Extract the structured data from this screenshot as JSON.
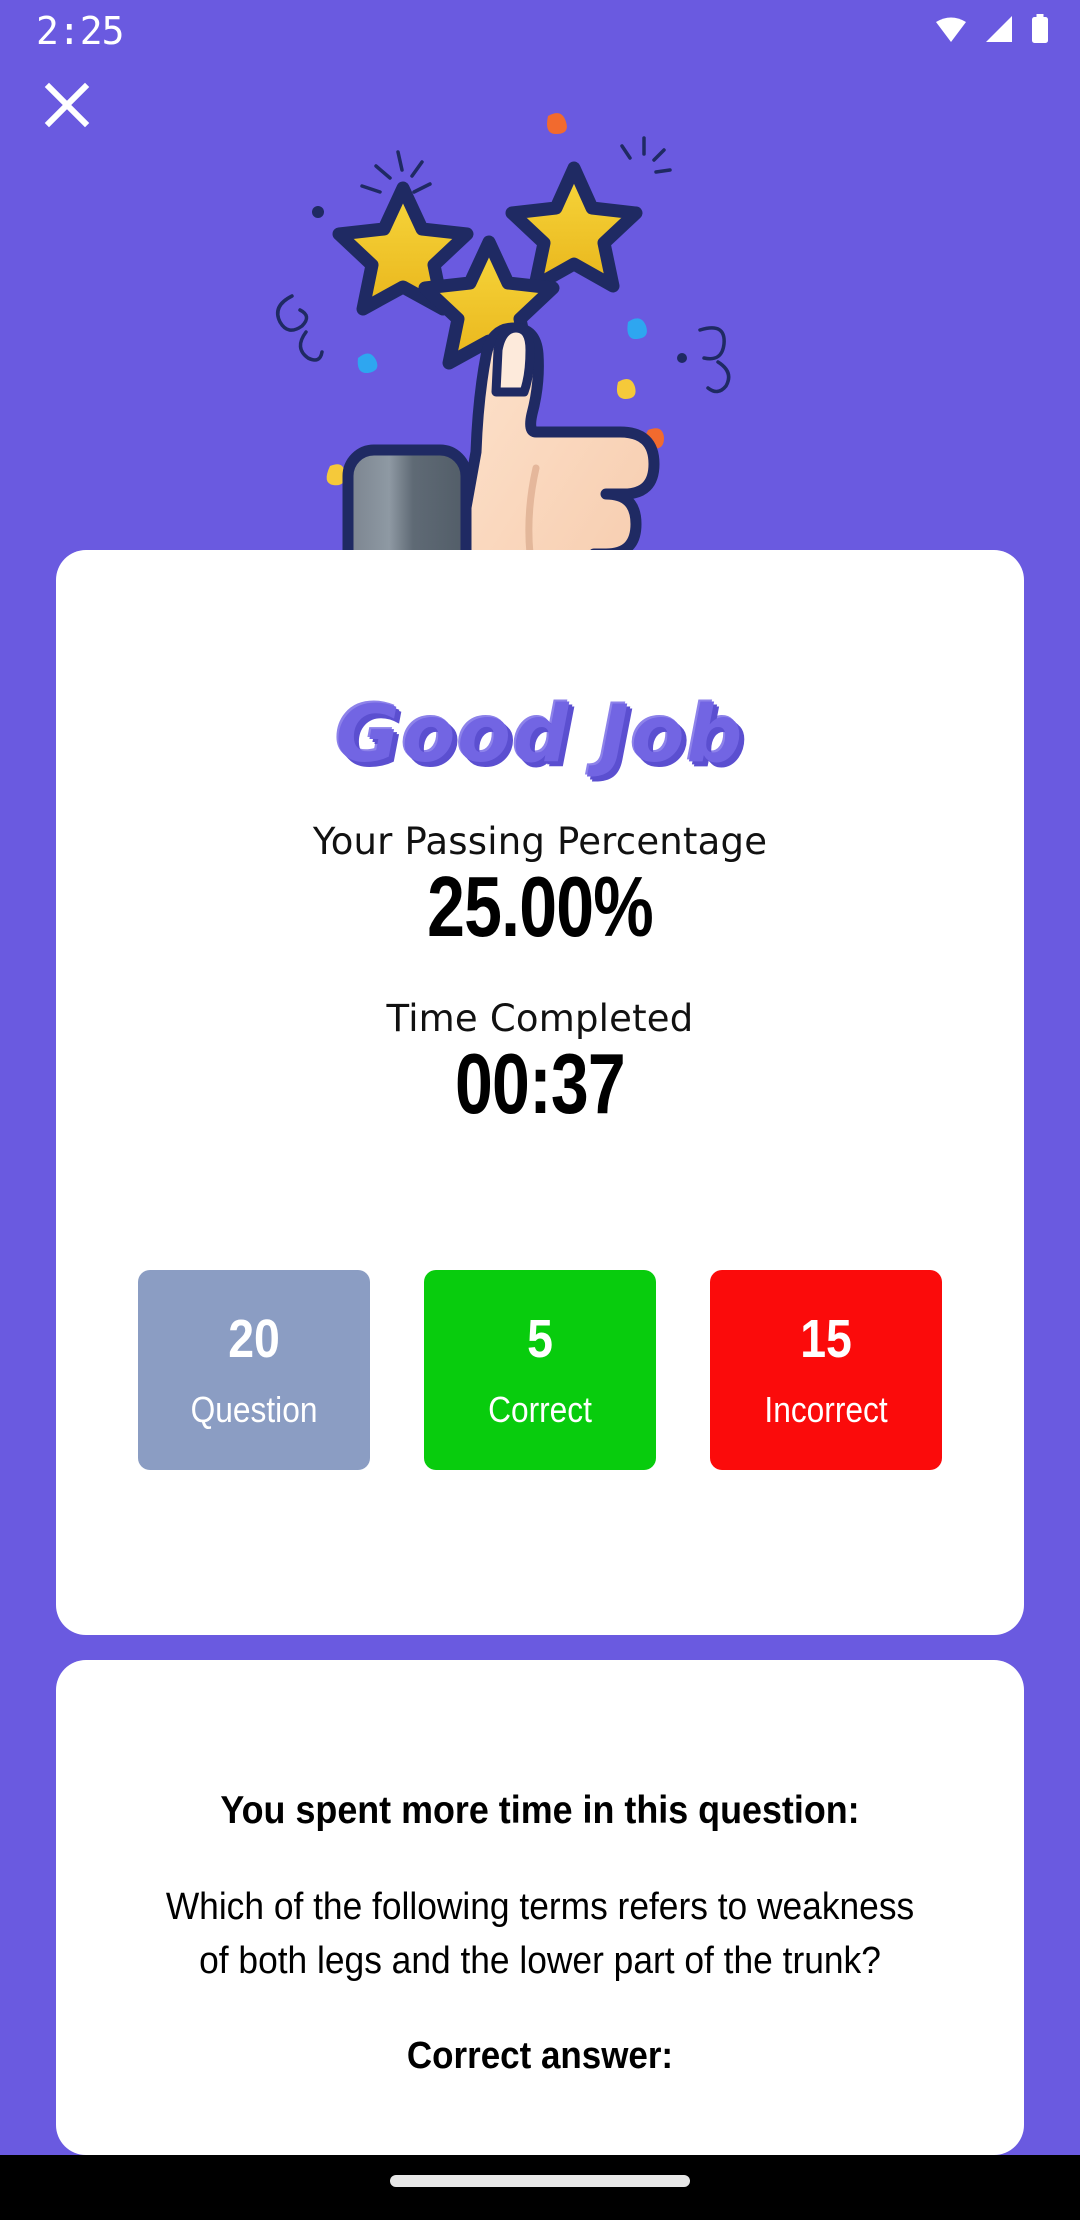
{
  "status_bar": {
    "clock": "2:25",
    "icons": [
      "wifi-icon",
      "cellular-signal-icon",
      "battery-icon"
    ]
  },
  "header": {
    "close_icon": "close-icon"
  },
  "hero": {
    "illustration": "thumbs-up-with-stars-and-confetti",
    "wordmark": "Good Job",
    "wordmark_color": "#7265e3",
    "star_color": "#f5cc22",
    "outline_color": "#1f2a63",
    "skin_color": "#fbd9c0",
    "cuff_color": "#667080"
  },
  "background": {
    "page_color": "#6a5ae0",
    "card_color": "#ffffff"
  },
  "result_card": {
    "percentage_label": "Your Passing Percentage",
    "percentage_value": "25.00%",
    "time_label": "Time Completed",
    "time_value": "00:37",
    "stats": [
      {
        "value": "20",
        "caption": "Question",
        "color": "#8b9dc3",
        "name": "question"
      },
      {
        "value": "5",
        "caption": "Correct",
        "color": "#08cc0d",
        "name": "correct"
      },
      {
        "value": "15",
        "caption": "Incorrect",
        "color": "#fb0b0b",
        "name": "incorrect"
      }
    ]
  },
  "review_card": {
    "heading": "You spent more time in this question:",
    "question": "Which of the following terms refers to weakness of both legs and the lower part of the trunk?",
    "answer_label": "Correct answer:"
  },
  "nav_bar": {
    "home_indicator": "home-indicator"
  }
}
